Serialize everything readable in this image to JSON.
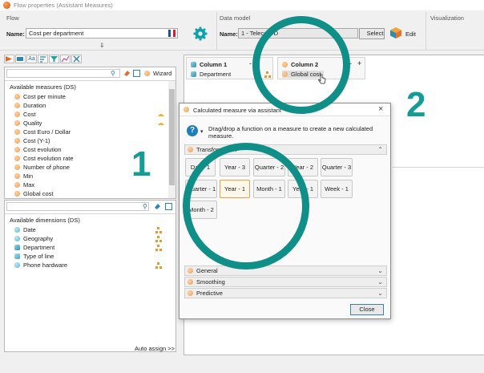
{
  "window": {
    "title": "Flow properties (Assistant Measures)"
  },
  "flow": {
    "section_label": "Flow",
    "name_label": "Name:",
    "name_value": "Cost per department"
  },
  "data_model": {
    "section_label": "Data model",
    "name_label": "Name:",
    "name_value": "1 - Telecom D",
    "select_label": "Select",
    "edit_label": "Edit"
  },
  "visualization": {
    "section_label": "Visualization"
  },
  "measures": {
    "wizard_label": "Wizard",
    "header": "Available measures (DS)",
    "items": [
      "Cost per minute",
      "Duration",
      "Cost",
      "Quality",
      "Cost Euro / Dollar",
      "Cost (Y-1)",
      "Cost evolution",
      "Cost evolution rate",
      "Number of phone",
      "Min",
      "Max",
      "Global cost"
    ]
  },
  "dimensions": {
    "header": "Available dimensions (DS)",
    "items": [
      "Date",
      "Geography",
      "Department",
      "Type of line",
      "Phone hardware"
    ],
    "auto_assign": "Auto assign >>"
  },
  "columns": {
    "col1": {
      "title": "Column 1",
      "item": "Department",
      "minus": "-"
    },
    "col2": {
      "title": "Column 2",
      "item": "Global cost",
      "minus": "-",
      "plus": "+"
    }
  },
  "dialog": {
    "title": "Calculated measure via assistant",
    "close_x": "×",
    "help_text": "Drag/drop a function on a measure to create a new calculated measure.",
    "sections": [
      {
        "label": "Transformation",
        "expanded": true
      },
      {
        "label": "General",
        "expanded": false
      },
      {
        "label": "Smoothing",
        "expanded": false
      },
      {
        "label": "Predictive",
        "expanded": false
      }
    ],
    "functions": [
      "Day - 1",
      "Year - 3",
      "Quarter - 2",
      "Year - 2",
      "Quarter - 3",
      "Quarter - 1",
      "Year - 1",
      "Month - 1",
      "Year - 1",
      "Week - 1",
      "Month - 2"
    ],
    "close_label": "Close"
  },
  "annotations": {
    "step1": "1",
    "step2": "2"
  },
  "colors": {
    "accent_teal": "#0f8f88",
    "number_teal": "#159c94",
    "orange": "#f39c4f"
  },
  "icons": {
    "gear": "gear-icon",
    "cube": "cube-icon",
    "search": "search-icon",
    "help": "help-icon",
    "close": "close-icon",
    "cursor": "cursor-icon"
  }
}
